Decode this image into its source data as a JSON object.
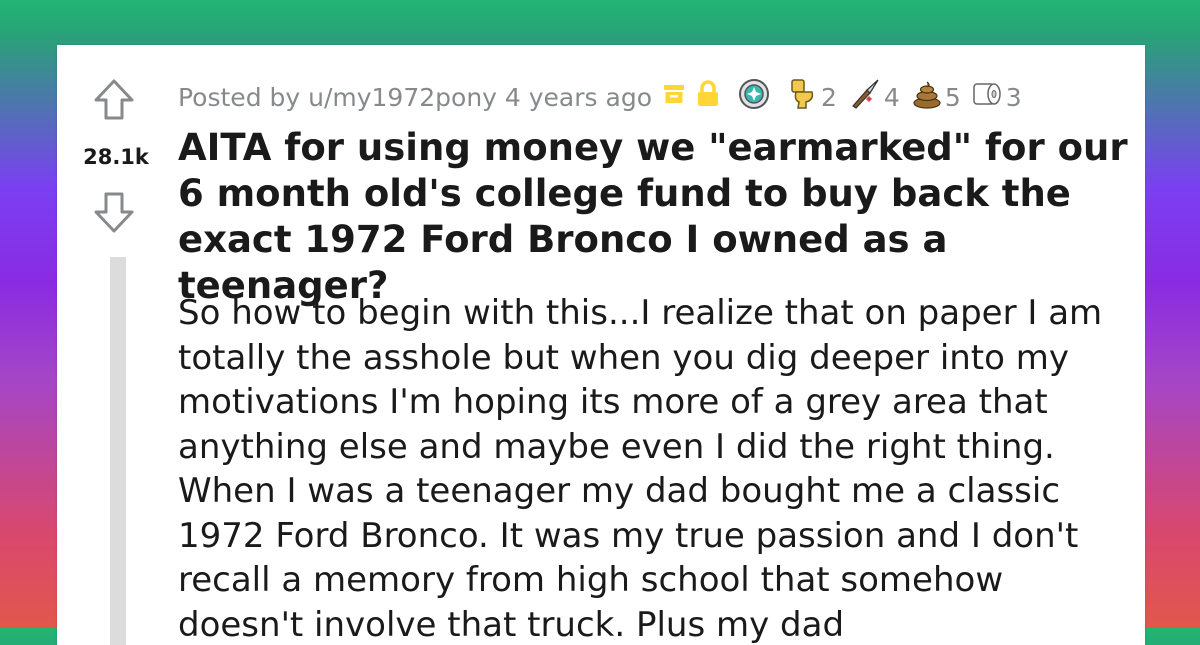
{
  "post": {
    "posted_by": "Posted by u/my1972pony 4 years ago",
    "score": "28.1k",
    "title": "AITA for using money we \"earmarked\" for our 6 month old's college fund to buy back the exact 1972 Ford Bronco I owned as a teenager?",
    "body": "So how to begin with this...I realize that on paper I am totally the asshole but when you dig deeper into my motivations I'm hoping its more of a grey area that anything else and maybe even I did the right thing. When I was a teenager my dad bought me a classic 1972 Ford Bronco. It was my true passion and I don't recall a memory from high school that somehow doesn't involve that truck. Plus my dad"
  },
  "awards": [
    {
      "icon": "archived-icon",
      "count": ""
    },
    {
      "icon": "lock-icon",
      "count": ""
    },
    {
      "icon": "silver-medal-award-icon",
      "count": ""
    },
    {
      "icon": "toilet-award-icon",
      "count": "2"
    },
    {
      "icon": "knife-award-icon",
      "count": "4"
    },
    {
      "icon": "poop-award-icon",
      "count": "5"
    },
    {
      "icon": "toilet-paper-award-icon",
      "count": "3"
    }
  ],
  "colors": {
    "meta_text": "#878a8c",
    "archive_yellow": "#ffd635",
    "lock_yellow": "#ffd635",
    "title_text": "#1a1a1b"
  }
}
